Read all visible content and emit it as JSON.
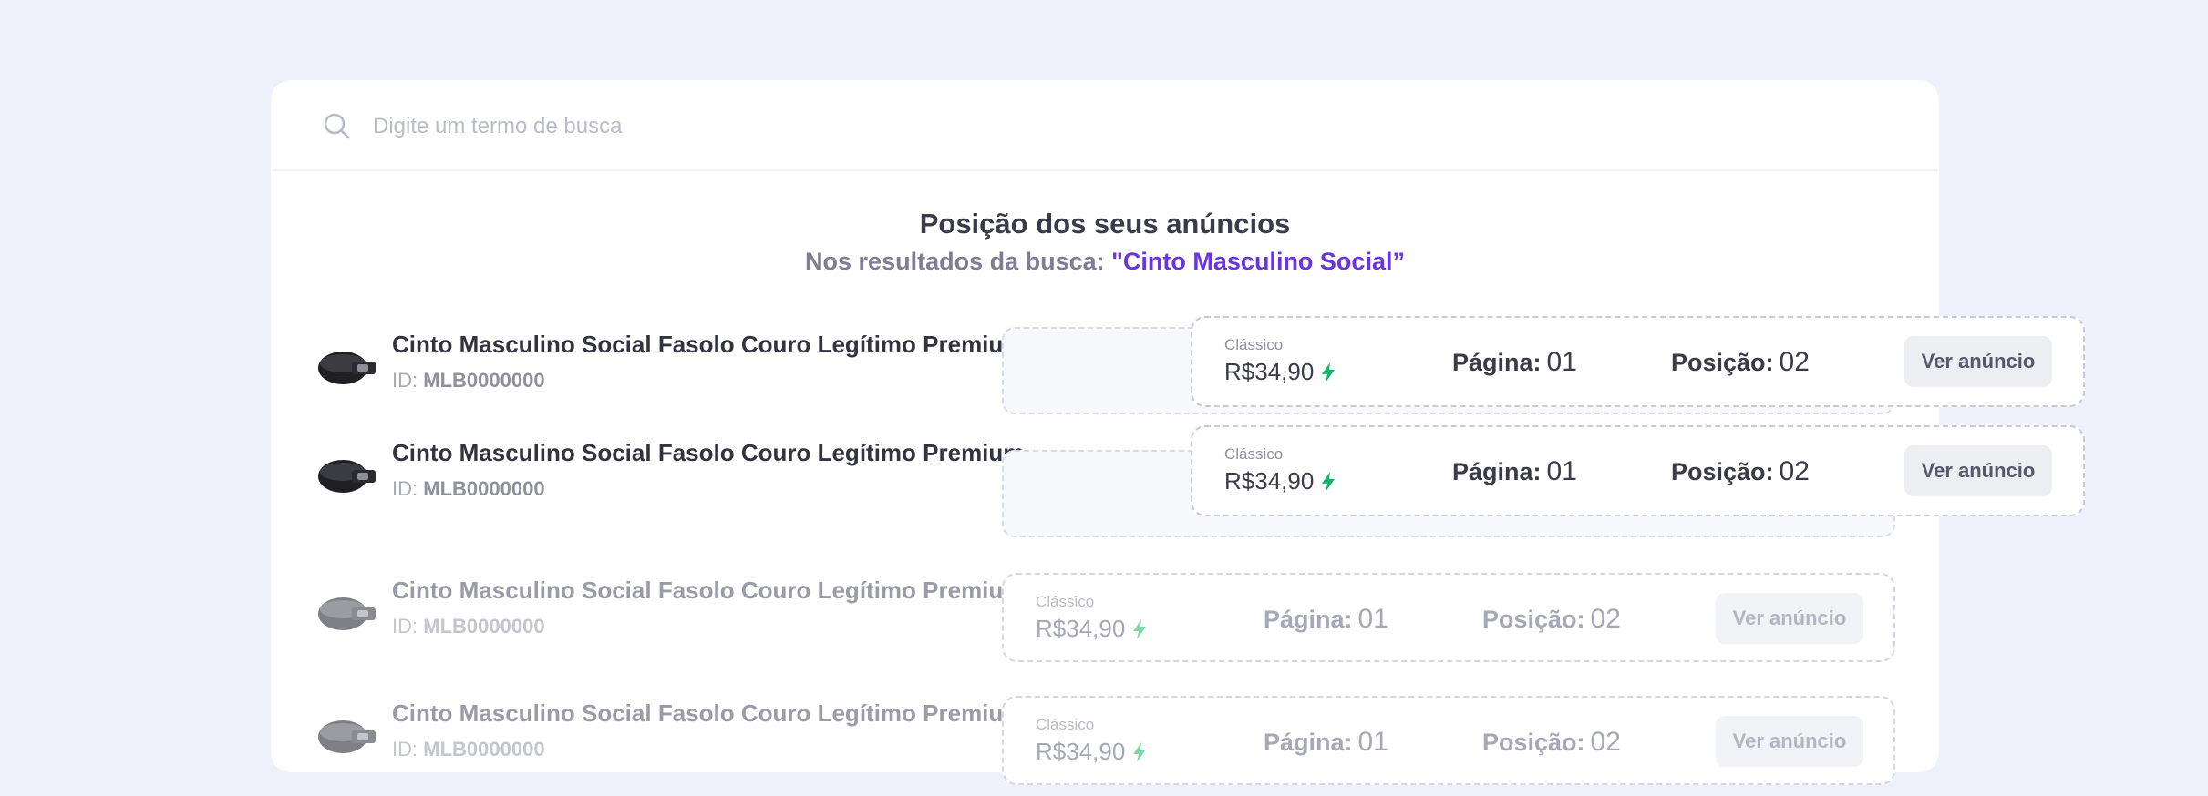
{
  "search": {
    "placeholder": "Digite um termo de busca",
    "value": ""
  },
  "header": {
    "title": "Posição dos seus anúncios",
    "subtitle_prefix": "Nos resultados da busca: ",
    "subtitle_term": "\"Cinto Masculino Social”"
  },
  "labels": {
    "id": "ID:",
    "page": "Página:",
    "position": "Posição:"
  },
  "colors": {
    "accent": "#6a35e0",
    "bolt": "#16b26a"
  },
  "items": [
    {
      "title": "Cinto Masculino Social Fasolo Couro Legítimo Premium",
      "id": "MLB0000000",
      "type": "Clássico",
      "price": "R$34,90",
      "page": "01",
      "position": "02",
      "button": "Ver anúncio"
    },
    {
      "title": "Cinto Masculino Social Fasolo Couro Legítimo Premium",
      "id": "MLB0000000",
      "type": "Clássico",
      "price": "R$34,90",
      "page": "01",
      "position": "02",
      "button": "Ver anúncio"
    },
    {
      "title": "Cinto Masculino Social Fasolo Couro Legítimo Premium",
      "id": "MLB0000000",
      "type": "Clássico",
      "price": "R$34,90",
      "page": "01",
      "position": "02",
      "button": "Ver anúncio"
    },
    {
      "title": "Cinto Masculino Social Fasolo Couro Legítimo Premium",
      "id": "MLB0000000",
      "type": "Clássico",
      "price": "R$34,90",
      "page": "01",
      "position": "02",
      "button": "Ver anúncio"
    }
  ]
}
